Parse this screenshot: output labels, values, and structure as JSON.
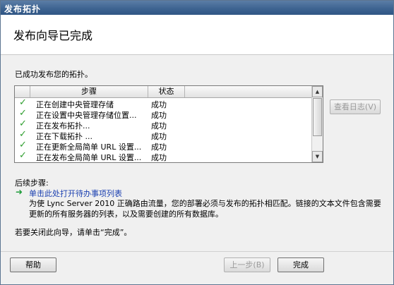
{
  "window": {
    "title": "发布拓扑"
  },
  "header": {
    "heading": "发布向导已完成"
  },
  "intro": "已成功发布您的拓扑。",
  "table": {
    "columns": [
      "步骤",
      "状态"
    ],
    "rows": [
      {
        "step": "正在创建中央管理存储",
        "status": "成功"
      },
      {
        "step": "正在设置中央管理存储位置...",
        "status": "成功"
      },
      {
        "step": "正在发布拓扑...",
        "status": "成功"
      },
      {
        "step": "正在下载拓扑 ...",
        "status": "成功"
      },
      {
        "step": "正在更新全局简单 URL 设置...",
        "status": "成功"
      },
      {
        "step": "正在发布全局简单 URL 设置...",
        "status": "成功"
      }
    ]
  },
  "view_log_label": "查看日志(V)",
  "next_steps": {
    "title": "后续步骤:",
    "link": "单击此处打开待办事项列表",
    "description": "为使 Lync Server 2010 正确路由流量，您的部署必须与发布的拓扑相匹配。链接的文本文件包含需要更新的所有服务器的列表，以及需要创建的所有数据库。"
  },
  "close_hint": "若要关闭此向导，请单击“完成”。",
  "buttons": {
    "help": "帮助",
    "back": "上一步(B)",
    "finish": "完成"
  },
  "colors": {
    "title_bar": "#3e6491",
    "link": "#1a3fb0",
    "check": "#2f9e2f"
  }
}
